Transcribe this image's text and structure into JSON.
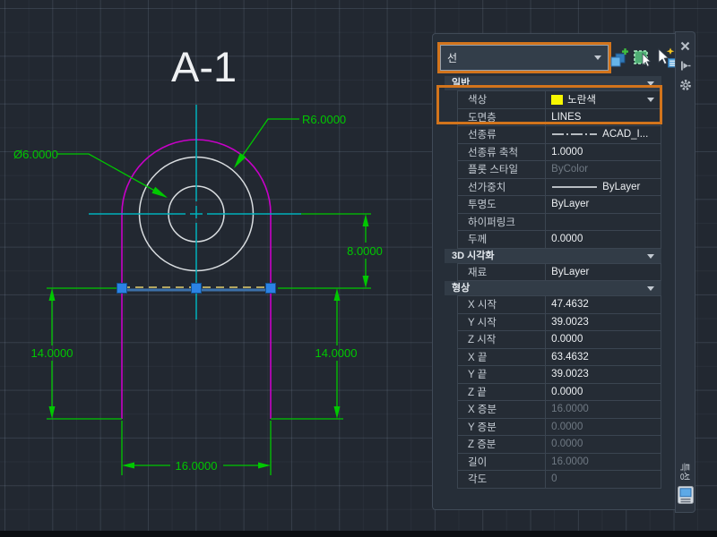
{
  "drawing": {
    "title": "A-1",
    "labels": {
      "radius": "R6.0000",
      "diameter": "Ø6.0000",
      "height": "8.0000",
      "side_left": "14.0000",
      "side_right": "14.0000",
      "width": "16.0000"
    }
  },
  "palette": {
    "title": "특성",
    "selector": {
      "value": "선"
    },
    "toolbar_icons": [
      "pickadd-toggle-icon",
      "select-objects-icon",
      "quick-select-icon"
    ],
    "titlebar_icons": [
      "close-icon",
      "auto-hide-pin-icon",
      "settings-gear-icon",
      "display-icon"
    ],
    "sections": [
      {
        "title": "일반",
        "rows": [
          {
            "label": "색상",
            "value": "노란색",
            "swatch": "#f7f700",
            "dropdown": true,
            "readonly": false
          },
          {
            "label": "도면층",
            "value": "LINES",
            "readonly": false
          },
          {
            "label": "선종류",
            "value": "ACAD_I...",
            "preview": "dashdot",
            "readonly": false
          },
          {
            "label": "선종류 축척",
            "value": "1.0000",
            "readonly": false
          },
          {
            "label": "플롯 스타일",
            "value": "ByColor",
            "readonly": true
          },
          {
            "label": "선가중치",
            "value": "ByLayer",
            "preview": "solid",
            "readonly": false
          },
          {
            "label": "투명도",
            "value": "ByLayer",
            "readonly": false
          },
          {
            "label": "하이퍼링크",
            "value": "",
            "readonly": false
          },
          {
            "label": "두께",
            "value": "0.0000",
            "readonly": false
          }
        ]
      },
      {
        "title": "3D 시각화",
        "rows": [
          {
            "label": "재료",
            "value": "ByLayer",
            "readonly": false
          }
        ]
      },
      {
        "title": "형상",
        "rows": [
          {
            "label": "X 시작",
            "value": "47.4632",
            "readonly": false
          },
          {
            "label": "Y 시작",
            "value": "39.0023",
            "readonly": false
          },
          {
            "label": "Z 시작",
            "value": "0.0000",
            "readonly": false
          },
          {
            "label": "X 끝",
            "value": "63.4632",
            "readonly": false
          },
          {
            "label": "Y 끝",
            "value": "39.0023",
            "readonly": false
          },
          {
            "label": "Z 끝",
            "value": "0.0000",
            "readonly": false
          },
          {
            "label": "X 증분",
            "value": "16.0000",
            "readonly": true
          },
          {
            "label": "Y 증분",
            "value": "0.0000",
            "readonly": true
          },
          {
            "label": "Z 증분",
            "value": "0.0000",
            "readonly": true
          },
          {
            "label": "길이",
            "value": "16.0000",
            "readonly": true
          },
          {
            "label": "각도",
            "value": "0",
            "readonly": true
          }
        ]
      }
    ]
  },
  "colors": {
    "accent_orange": "#d2741c",
    "entity_yellow": "#f7f700",
    "dim_green": "#00c800",
    "outline_magenta": "#c800c8",
    "centerline_cyan": "#00b0bb",
    "grip_blue": "#2b82e4",
    "entity_white": "#d9dde0"
  }
}
